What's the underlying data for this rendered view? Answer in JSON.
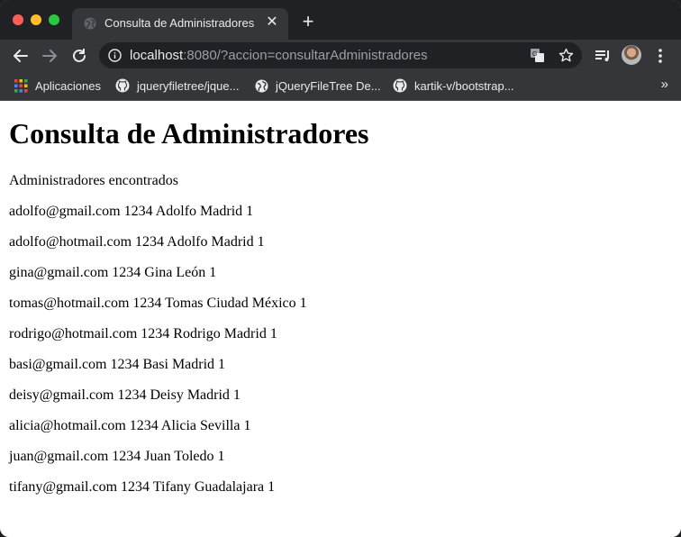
{
  "tab": {
    "title": "Consulta de Administradores",
    "close_glyph": "✕",
    "new_tab_glyph": "+"
  },
  "address": {
    "host": "localhost",
    "rest": ":8080/?accion=consultarAdministradores"
  },
  "bookmarks": {
    "items": [
      {
        "label": "Aplicaciones",
        "icon": "apps-grid-icon"
      },
      {
        "label": "jqueryfiletree/jque...",
        "icon": "github-icon"
      },
      {
        "label": "jQueryFileTree De...",
        "icon": "globe-icon"
      },
      {
        "label": "kartik-v/bootstrap...",
        "icon": "github-icon"
      }
    ],
    "more_glyph": "»"
  },
  "page": {
    "heading": "Consulta de Administradores",
    "subtitle": "Administradores encontrados",
    "records": [
      "adolfo@gmail.com 1234 Adolfo Madrid 1",
      "adolfo@hotmail.com 1234 Adolfo Madrid 1",
      "gina@gmail.com 1234 Gina León 1",
      "tomas@hotmail.com 1234 Tomas Ciudad México 1",
      "rodrigo@hotmail.com 1234 Rodrigo Madrid 1",
      "basi@gmail.com 1234 Basi Madrid 1",
      "deisy@gmail.com 1234 Deisy Madrid 1",
      "alicia@hotmail.com 1234 Alicia Sevilla 1",
      "juan@gmail.com 1234 Juan Toledo 1",
      "tifany@gmail.com 1234 Tifany Guadalajara 1"
    ]
  },
  "colors": {
    "chrome_dark": "#202124",
    "toolbar": "#35363a",
    "text_light": "#e8eaed",
    "url_dim": "#9aa0a6",
    "page_bg": "#ffffff"
  }
}
